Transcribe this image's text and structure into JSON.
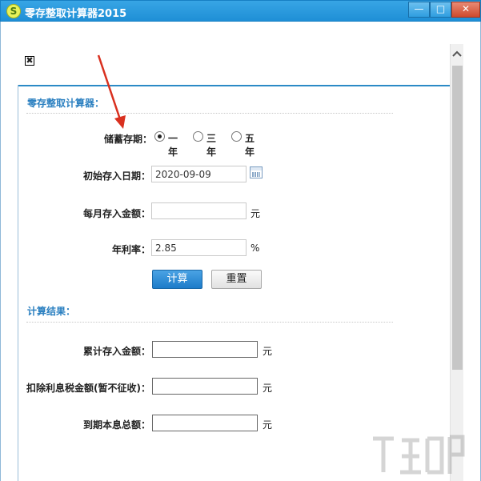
{
  "window": {
    "title": "零存整取计算器2015",
    "app_icon_glyph": "S",
    "minimize": "—",
    "maximize": "□",
    "close": "✕"
  },
  "close_box_glyph": "✖",
  "calculator": {
    "section_title": "零存整取计算器：",
    "term": {
      "label": "储蓄存期：",
      "options": [
        "一年",
        "三年",
        "五年"
      ],
      "selected": "一年"
    },
    "start_date": {
      "label": "初始存入日期：",
      "value": "2020-09-09"
    },
    "monthly_amount": {
      "label": "每月存入金额：",
      "value": "",
      "unit": "元"
    },
    "annual_rate": {
      "label": "年利率：",
      "value": "2.85",
      "unit": "%"
    },
    "calculate_label": "计算",
    "reset_label": "重置"
  },
  "results": {
    "section_title": "计算结果：",
    "total_deposit": {
      "label": "累计存入金额：",
      "value": "",
      "unit": "元"
    },
    "tax_deducted": {
      "label": "扣除利息税金额(暂不征收)：",
      "value": "",
      "unit": "元"
    },
    "maturity_total": {
      "label": "到期本息总额：",
      "value": "",
      "unit": "元"
    }
  },
  "colors": {
    "titlebar": "#1f8fd6",
    "accent": "#2a7fc0",
    "primary_button": "#1d7bc9",
    "annotation_arrow": "#d9301f"
  },
  "icons": {
    "app": "app-logo-icon",
    "calendar": "calendar-icon",
    "scroll_up": "chevron-up-icon",
    "close_box": "close-box-icon"
  }
}
